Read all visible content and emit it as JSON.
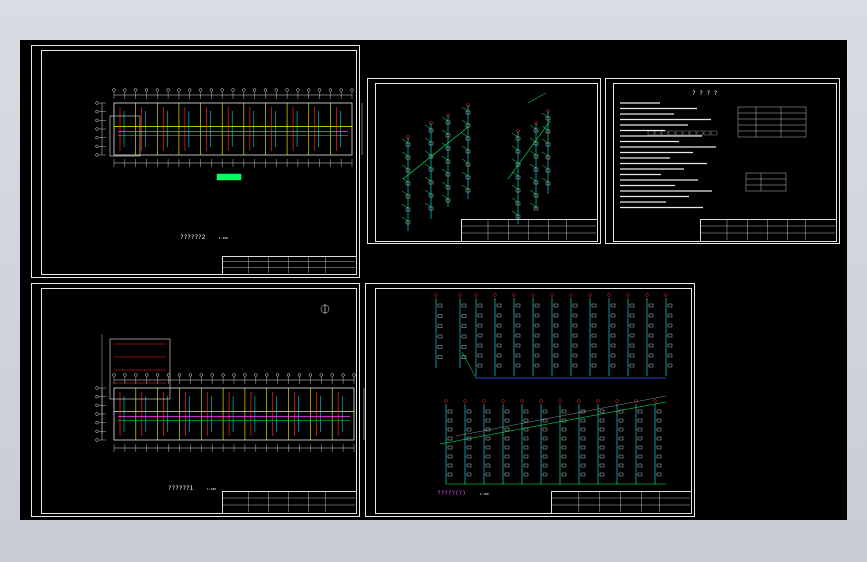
{
  "window": {
    "background_top": "#d9dce3",
    "background_bottom": "#c9ccd6"
  },
  "drawing": {
    "background": "#000000",
    "sheet_1": {
      "caption": "??????2",
      "scale": "1:100"
    },
    "sheet_3": {
      "title": "? ? ? ?"
    },
    "sheet_4": {
      "caption": "??????1",
      "scale": "1:100"
    },
    "sheet_5": {
      "caption": "?????(?)",
      "scale": "1:100"
    }
  },
  "colors": {
    "line_white": "#e8e8e8",
    "wall_yellow": "#ffff00",
    "pipe_red": "#ff2020",
    "pipe_green": "#00ff60",
    "pipe_cyan": "#00ffff",
    "pipe_magenta": "#ff40ff",
    "pipe_blue": "#4060ff"
  }
}
